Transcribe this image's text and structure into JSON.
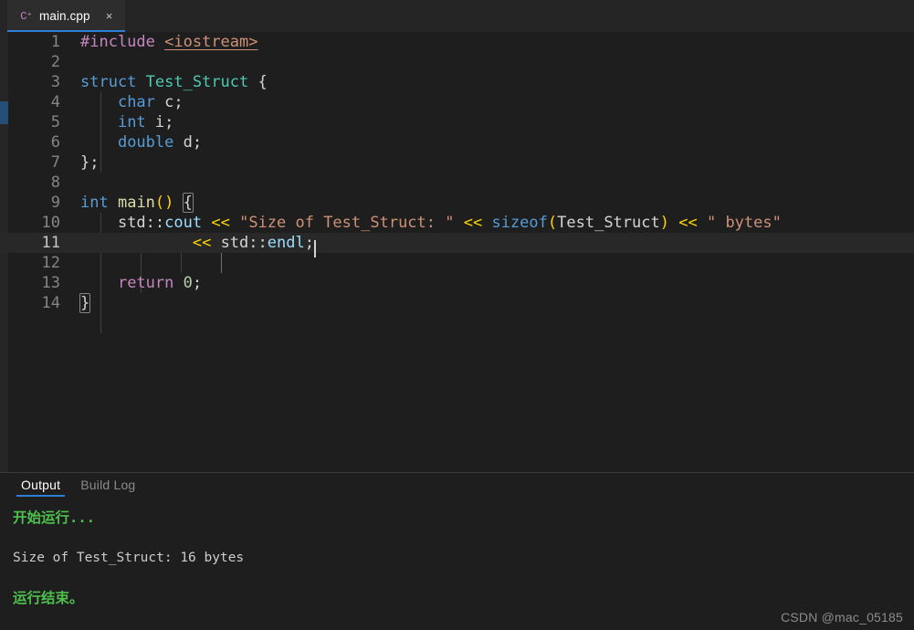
{
  "window": {
    "background": "#1e1e1e",
    "accent": "#2b7fd4"
  },
  "tabbar": {
    "tabs": [
      {
        "label": "main.cpp",
        "icon": "cpp-file-icon",
        "icon_glyph": "C⁺",
        "close_glyph": "×",
        "active": true
      }
    ]
  },
  "editor": {
    "language": "cpp",
    "active_line": 11,
    "cursor_line": 11,
    "cursor_column": 27,
    "lines": [
      {
        "n": "1",
        "text": "#include <iostream>"
      },
      {
        "n": "2",
        "text": ""
      },
      {
        "n": "3",
        "text": "struct Test_Struct {"
      },
      {
        "n": "4",
        "text": "    char c;"
      },
      {
        "n": "5",
        "text": "    int i;"
      },
      {
        "n": "6",
        "text": "    double d;"
      },
      {
        "n": "7",
        "text": "};"
      },
      {
        "n": "8",
        "text": ""
      },
      {
        "n": "9",
        "text": "int main() {"
      },
      {
        "n": "10",
        "text": "    std::cout << \"Size of Test_Struct: \" << sizeof(Test_Struct) << \" bytes\""
      },
      {
        "n": "11",
        "text": "            << std::endl;"
      },
      {
        "n": "12",
        "text": ""
      },
      {
        "n": "13",
        "text": "    return 0;"
      },
      {
        "n": "14",
        "text": "}"
      }
    ],
    "tokens": {
      "line1": {
        "pre": "#include",
        "include": "<iostream>"
      },
      "line3": {
        "kw": "struct",
        "type": "Test_Struct",
        "brace": "{"
      },
      "line4": {
        "kw": "char",
        "var": "c",
        "semi": ";"
      },
      "line5": {
        "kw": "int",
        "var": "i",
        "semi": ";"
      },
      "line6": {
        "kw": "double",
        "var": "d",
        "semi": ";"
      },
      "line7": {
        "text": "};"
      },
      "line9": {
        "kw": "int",
        "fn": "main",
        "parens": "()",
        "brace": "{"
      },
      "line10": {
        "ns": "std::",
        "obj": "cout",
        "op1": "<<",
        "str1": "\"Size of Test_Struct: \"",
        "op2": "<<",
        "kw": "sizeof",
        "lparen": "(",
        "arg": "Test_Struct",
        "rparen": ")",
        "op3": "<<",
        "str2": "\" bytes\""
      },
      "line11": {
        "op": "<<",
        "ns": "std::",
        "obj": "endl",
        "semi": ";"
      },
      "line13": {
        "ctl": "return",
        "num": "0",
        "semi": ";"
      },
      "line14": {
        "brace": "}"
      }
    }
  },
  "panel": {
    "tabs": [
      {
        "label": "Output",
        "active": true
      },
      {
        "label": "Build Log",
        "active": false
      }
    ],
    "output_lines": [
      {
        "text": "开始运行...",
        "style": "green"
      },
      {
        "text": "",
        "style": "spacer"
      },
      {
        "text": "Size of Test_Struct: 16 bytes",
        "style": "plain"
      },
      {
        "text": "",
        "style": "spacer"
      },
      {
        "text": "运行结束。",
        "style": "green"
      }
    ]
  },
  "watermark": {
    "text": "CSDN @mac_05185"
  }
}
